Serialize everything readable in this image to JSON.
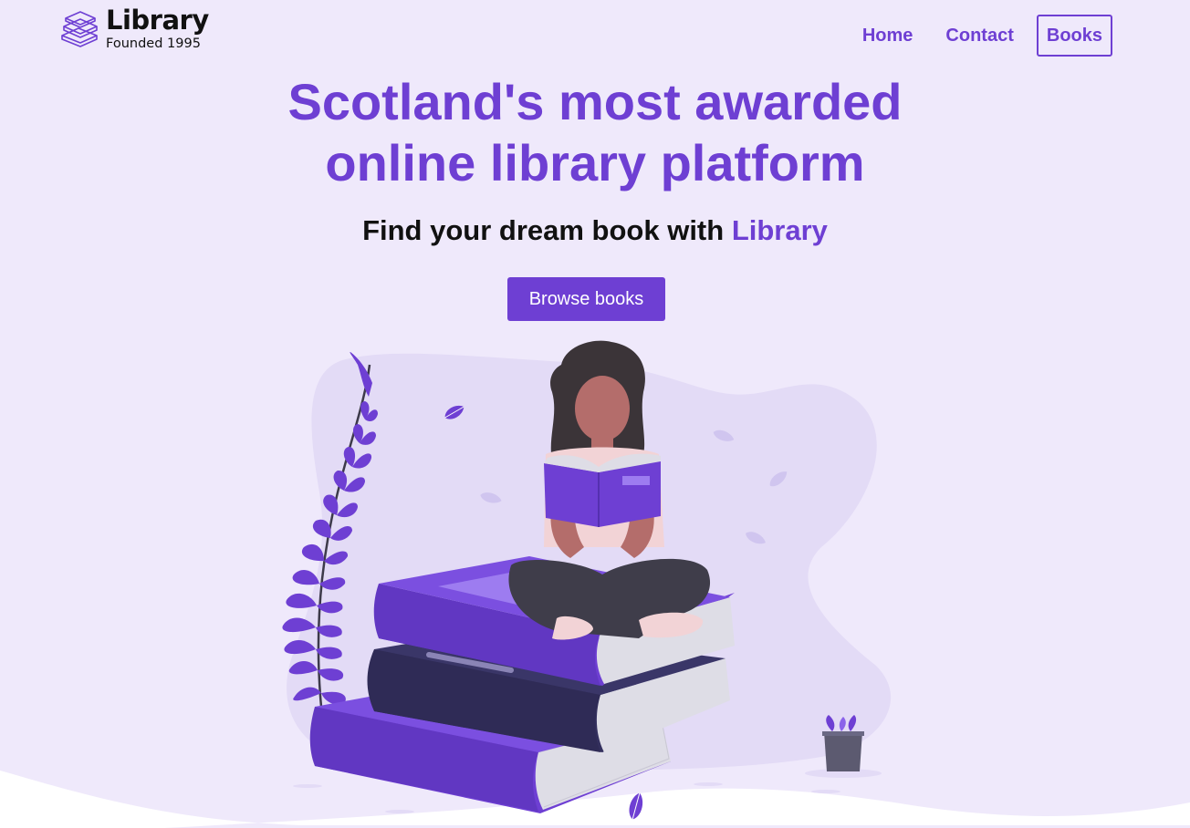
{
  "brand": {
    "name": "Library",
    "tagline": "Founded 1995",
    "icon": "stacked-books-icon"
  },
  "nav": {
    "items": [
      {
        "label": "Home",
        "active": false
      },
      {
        "label": "Contact",
        "active": false
      },
      {
        "label": "Books",
        "active": true
      }
    ]
  },
  "hero": {
    "headline_line1": "Scotland's most awarded",
    "headline_line2": "online library platform",
    "subhead_prefix": "Find your dream book with ",
    "subhead_accent": "Library",
    "cta_label": "Browse books",
    "illustration": "woman-reading-on-book-stack-illustration"
  },
  "colors": {
    "accent": "#6e3fd3",
    "background": "#efe9fb",
    "text": "#111111",
    "blob": "#e3dbf6"
  }
}
